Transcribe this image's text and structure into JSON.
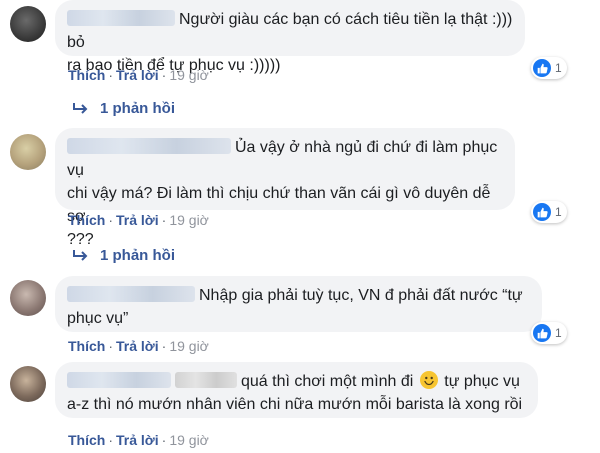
{
  "comments": [
    {
      "text_line1": "Người giàu các bạn có cách tiêu tiền lạ thật :))) bỏ",
      "text_line2": "ra bao tiền để tự phục vụ :)))))",
      "like": "Thích",
      "reply": "Trả lời",
      "time": "19 giờ",
      "reaction_count": "1",
      "replies_label": "1 phản hồi"
    },
    {
      "text_line1": "Ủa vậy ở nhà ngủ đi chứ đi làm phục vụ",
      "text_line2": "chi vậy má? Đi làm thì chịu chứ than vãn cái gì vô duyên dễ sợ",
      "text_line3": "???",
      "like": "Thích",
      "reply": "Trả lời",
      "time": "19 giờ",
      "reaction_count": "1",
      "replies_label": "1 phản hồi"
    },
    {
      "text_line1": "Nhập gia phải tuỳ tục, VN đ phải đất nước “tự",
      "text_line2": "phục vụ”",
      "like": "Thích",
      "reply": "Trả lời",
      "time": "19 giờ",
      "reaction_count": "1"
    },
    {
      "text_line1_a": "quá thì chơi một mình đi",
      "text_line1_b": "tự phục vụ",
      "text_line2": "a-z thì nó mướn nhân viên chi nữa mướn mỗi barista là xong rồi",
      "like": "Thích",
      "reply": "Trả lời",
      "time": "19 giờ"
    }
  ],
  "separator": "·",
  "colors": {
    "link": "#385898",
    "like_blue": "#1877f2",
    "bubble": "#f2f3f5"
  }
}
